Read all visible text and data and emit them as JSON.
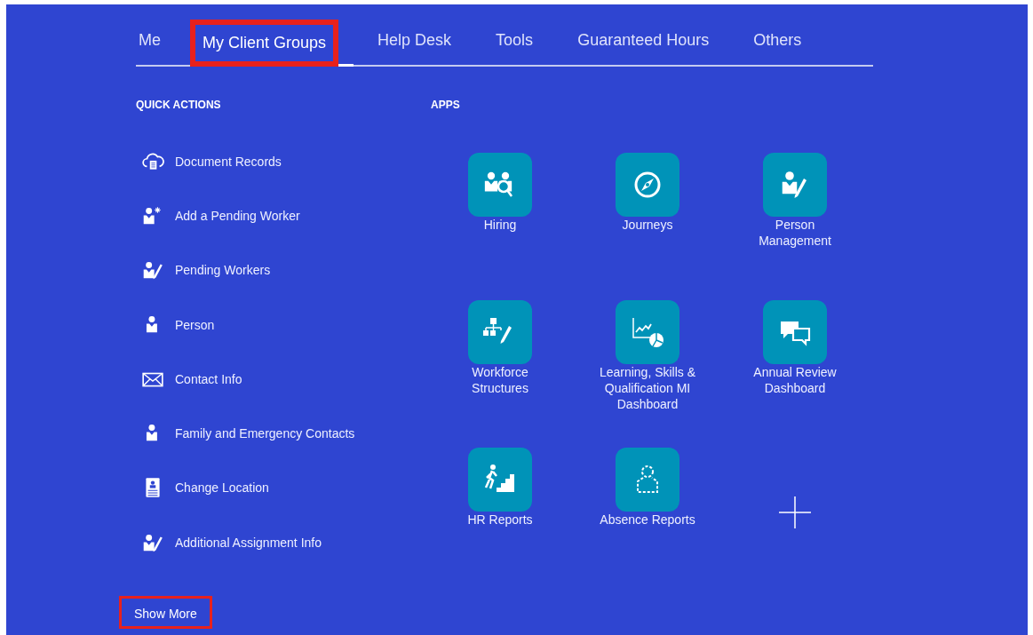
{
  "tabs": [
    {
      "label": "Me",
      "selected": false,
      "highlighted": false
    },
    {
      "label": "My Client Groups",
      "selected": true,
      "highlighted": true
    },
    {
      "label": "Help Desk",
      "selected": false,
      "highlighted": false
    },
    {
      "label": "Tools",
      "selected": false,
      "highlighted": false
    },
    {
      "label": "Guaranteed Hours",
      "selected": false,
      "highlighted": false
    },
    {
      "label": "Others",
      "selected": false,
      "highlighted": false
    }
  ],
  "quick_actions": {
    "heading": "QUICK ACTIONS",
    "items": [
      {
        "label": "Document Records"
      },
      {
        "label": "Add a Pending Worker"
      },
      {
        "label": "Pending Workers"
      },
      {
        "label": "Person"
      },
      {
        "label": "Contact Info"
      },
      {
        "label": "Family and Emergency Contacts"
      },
      {
        "label": "Change Location"
      },
      {
        "label": "Additional Assignment Info"
      }
    ],
    "show_more": {
      "label": "Show More",
      "highlighted": true
    }
  },
  "apps": {
    "heading": "APPS",
    "items": [
      {
        "label": "Hiring"
      },
      {
        "label": "Journeys"
      },
      {
        "label": "Person Management"
      },
      {
        "label": "Workforce Structures"
      },
      {
        "label": "Learning, Skills & Qualification MI Dashboard"
      },
      {
        "label": "Annual Review Dashboard"
      },
      {
        "label": "HR Reports"
      },
      {
        "label": "Absence Reports"
      }
    ]
  }
}
